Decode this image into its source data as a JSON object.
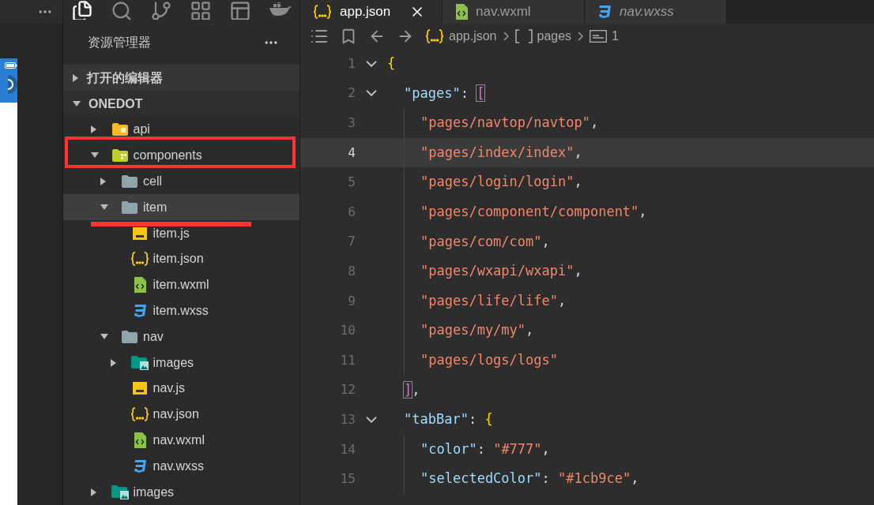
{
  "tabs": [
    {
      "label": "app.json",
      "kind": "json",
      "selected": true,
      "preview": false
    },
    {
      "label": "nav.wxml",
      "kind": "wxml",
      "selected": false,
      "preview": false
    },
    {
      "label": "nav.wxss",
      "kind": "wxss",
      "selected": false,
      "preview": true
    }
  ],
  "breadcrumb": [
    {
      "label": "app.json",
      "kind": "json"
    },
    {
      "label": "pages",
      "kind": "array"
    },
    {
      "label": "1",
      "kind": "string"
    }
  ],
  "explorer": {
    "title": "资源管理器",
    "sections": [
      {
        "label": "打开的编辑器",
        "expanded": false
      },
      {
        "label": "ONEDOT",
        "expanded": true,
        "children": [
          {
            "label": "api",
            "kind": "api-folder",
            "expanded": false,
            "selected": false
          },
          {
            "label": "components",
            "kind": "component-folder",
            "expanded": true,
            "selected": false,
            "children": [
              {
                "label": "cell",
                "kind": "folder",
                "expanded": false,
                "selected": false
              },
              {
                "label": "item",
                "kind": "folder",
                "expanded": true,
                "selected": true,
                "children": [
                  {
                    "label": "item.js",
                    "kind": "js",
                    "selected": false
                  },
                  {
                    "label": "item.json",
                    "kind": "json",
                    "selected": false
                  },
                  {
                    "label": "item.wxml",
                    "kind": "wxml",
                    "selected": false
                  },
                  {
                    "label": "item.wxss",
                    "kind": "wxss",
                    "selected": false
                  }
                ]
              },
              {
                "label": "nav",
                "kind": "folder",
                "expanded": true,
                "selected": false,
                "children": [
                  {
                    "label": "images",
                    "kind": "image-folder",
                    "expanded": false,
                    "selected": false
                  },
                  {
                    "label": "nav.js",
                    "kind": "js",
                    "selected": false
                  },
                  {
                    "label": "nav.json",
                    "kind": "json",
                    "selected": false
                  },
                  {
                    "label": "nav.wxml",
                    "kind": "wxml",
                    "selected": false
                  },
                  {
                    "label": "nav.wxss",
                    "kind": "wxss",
                    "selected": false
                  }
                ]
              }
            ]
          },
          {
            "label": "images",
            "kind": "image-folder",
            "expanded": false,
            "selected": false
          }
        ]
      }
    ]
  },
  "editor": {
    "lines": [
      {
        "number": "1",
        "current": false,
        "foldable": true,
        "tokens": [
          {
            "text": "{",
            "kind": "brace-open"
          }
        ]
      },
      {
        "number": "2",
        "current": false,
        "foldable": true,
        "tokens": [
          {
            "text": "\"pages\"",
            "kind": "key"
          },
          {
            "text": ": ",
            "kind": "punct"
          },
          {
            "text": "[",
            "kind": "bracket-open",
            "matched": true
          }
        ]
      },
      {
        "number": "3",
        "current": false,
        "foldable": false,
        "tokens": [
          {
            "text": "\"pages/navtop/navtop\"",
            "kind": "string"
          },
          {
            "text": ",",
            "kind": "punct"
          }
        ]
      },
      {
        "number": "4",
        "current": true,
        "foldable": false,
        "tokens": [
          {
            "text": "\"pages/index/index\"",
            "kind": "string"
          },
          {
            "text": ",",
            "kind": "punct"
          }
        ]
      },
      {
        "number": "5",
        "current": false,
        "foldable": false,
        "tokens": [
          {
            "text": "\"pages/login/login\"",
            "kind": "string"
          },
          {
            "text": ",",
            "kind": "punct"
          }
        ]
      },
      {
        "number": "6",
        "current": false,
        "foldable": false,
        "tokens": [
          {
            "text": "\"pages/component/component\"",
            "kind": "string"
          },
          {
            "text": ",",
            "kind": "punct"
          }
        ]
      },
      {
        "number": "7",
        "current": false,
        "foldable": false,
        "tokens": [
          {
            "text": "\"pages/com/com\"",
            "kind": "string"
          },
          {
            "text": ",",
            "kind": "punct"
          }
        ]
      },
      {
        "number": "8",
        "current": false,
        "foldable": false,
        "tokens": [
          {
            "text": "\"pages/wxapi/wxapi\"",
            "kind": "string"
          },
          {
            "text": ",",
            "kind": "punct"
          }
        ]
      },
      {
        "number": "9",
        "current": false,
        "foldable": false,
        "tokens": [
          {
            "text": "\"pages/life/life\"",
            "kind": "string"
          },
          {
            "text": ",",
            "kind": "punct"
          }
        ]
      },
      {
        "number": "10",
        "current": false,
        "foldable": false,
        "tokens": [
          {
            "text": "\"pages/my/my\"",
            "kind": "string"
          },
          {
            "text": ",",
            "kind": "punct"
          }
        ]
      },
      {
        "number": "11",
        "current": false,
        "foldable": false,
        "tokens": [
          {
            "text": "\"pages/logs/logs\"",
            "kind": "string"
          }
        ]
      },
      {
        "number": "12",
        "current": false,
        "foldable": false,
        "tokens": [
          {
            "text": "]",
            "kind": "bracket-close",
            "matched": true
          },
          {
            "text": ",",
            "kind": "punct"
          }
        ]
      },
      {
        "number": "13",
        "current": false,
        "foldable": true,
        "tokens": [
          {
            "text": "\"tabBar\"",
            "kind": "key"
          },
          {
            "text": ": ",
            "kind": "punct"
          },
          {
            "text": "{",
            "kind": "brace-open",
            "matched": false
          }
        ]
      },
      {
        "number": "14",
        "current": false,
        "foldable": false,
        "tokens": [
          {
            "text": "\"color\"",
            "kind": "key"
          },
          {
            "text": ": ",
            "kind": "punct"
          },
          {
            "text": "\"#777\"",
            "kind": "string"
          },
          {
            "text": ",",
            "kind": "punct"
          }
        ]
      },
      {
        "number": "15",
        "current": false,
        "foldable": false,
        "tokens": [
          {
            "text": "\"selectedColor\"",
            "kind": "key"
          },
          {
            "text": ": ",
            "kind": "punct"
          },
          {
            "text": "\"#1cb9ce\"",
            "kind": "string"
          },
          {
            "text": ",",
            "kind": "punct"
          }
        ]
      }
    ]
  }
}
